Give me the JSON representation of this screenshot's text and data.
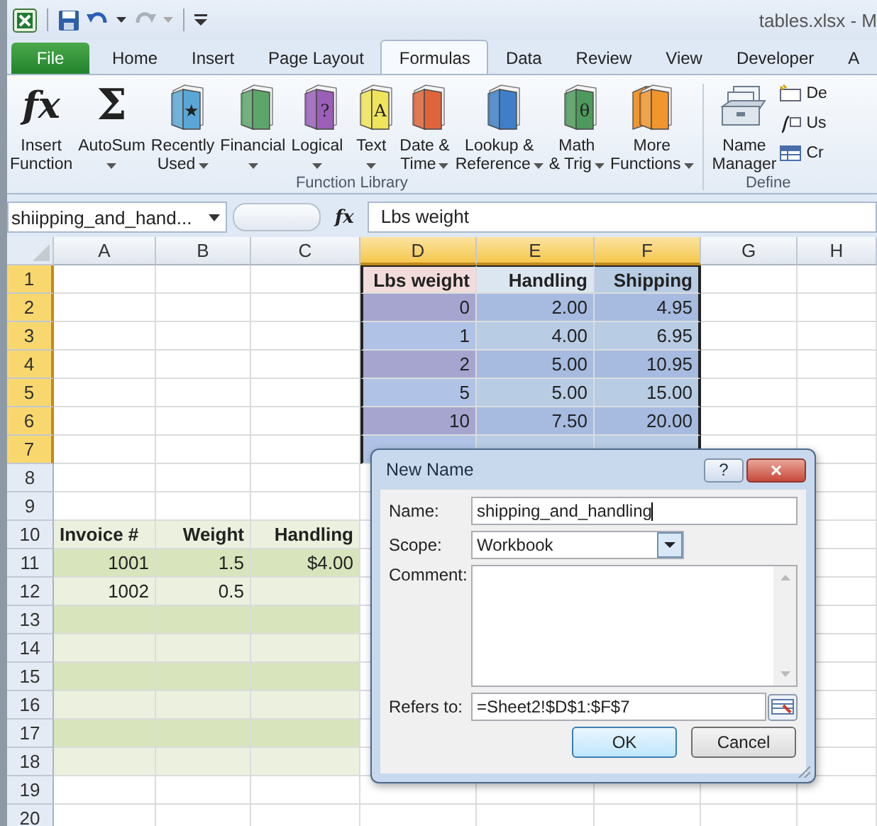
{
  "title_bar": {
    "title": "tables.xlsx  -  M"
  },
  "tabs": [
    {
      "label": "File",
      "kind": "file",
      "selected": false
    },
    {
      "label": "Home",
      "kind": "tab",
      "selected": false
    },
    {
      "label": "Insert",
      "kind": "tab",
      "selected": false
    },
    {
      "label": "Page Layout",
      "kind": "tab",
      "selected": false
    },
    {
      "label": "Formulas",
      "kind": "tab",
      "selected": true
    },
    {
      "label": "Data",
      "kind": "tab",
      "selected": false
    },
    {
      "label": "Review",
      "kind": "tab",
      "selected": false
    },
    {
      "label": "View",
      "kind": "tab",
      "selected": false
    },
    {
      "label": "Developer",
      "kind": "tab",
      "selected": false
    },
    {
      "label": "A",
      "kind": "tab",
      "selected": false
    }
  ],
  "ribbon": {
    "groups": [
      {
        "label": "Function Library",
        "buttons": [
          {
            "lines": [
              "Insert",
              "Function"
            ],
            "kind": "glyph",
            "glyph": "fx",
            "dropdown": false
          },
          {
            "lines": [
              "AutoSum"
            ],
            "kind": "glyph",
            "glyph": "Σ",
            "dropdown": true
          },
          {
            "lines": [
              "Recently",
              "Used"
            ],
            "kind": "book",
            "color": "#5aa7d6",
            "glyph": "★",
            "dropdown": true
          },
          {
            "lines": [
              "Financial"
            ],
            "kind": "book",
            "color": "#5ea56a",
            "dropdown": true
          },
          {
            "lines": [
              "Logical"
            ],
            "kind": "book",
            "color": "#9b5fb8",
            "glyph": "?",
            "dropdown": true
          },
          {
            "lines": [
              "Text"
            ],
            "kind": "book",
            "color": "#efe45a",
            "glyph": "A",
            "dropdown": true
          },
          {
            "lines": [
              "Date &",
              "Time"
            ],
            "kind": "book",
            "color": "#e0643a",
            "dropdown": true
          },
          {
            "lines": [
              "Lookup &",
              "Reference"
            ],
            "kind": "book",
            "color": "#3f7fc8",
            "dropdown": true
          },
          {
            "lines": [
              "Math",
              "& Trig"
            ],
            "kind": "book",
            "color": "#4e9a5c",
            "glyph": "θ",
            "dropdown": true
          },
          {
            "lines": [
              "More",
              "Functions"
            ],
            "kind": "books",
            "color": "#f0962e",
            "dropdown": true
          }
        ]
      },
      {
        "label": "Define",
        "buttons": [
          {
            "lines": [
              "Name",
              "Manager"
            ],
            "kind": "cards",
            "dropdown": false
          }
        ],
        "small_buttons": [
          {
            "label": "De",
            "kind": "tag"
          },
          {
            "label": "Us",
            "kind": "fx"
          },
          {
            "label": "Cr",
            "kind": "grid"
          }
        ]
      }
    ]
  },
  "formula_bar": {
    "name_box": "shiipping_and_hand...",
    "function_glyph": "fx",
    "value": "Lbs weight"
  },
  "sheet": {
    "columns": [
      {
        "label": "A",
        "selected": false
      },
      {
        "label": "B",
        "selected": false
      },
      {
        "label": "C",
        "selected": false
      },
      {
        "label": "D",
        "selected": true
      },
      {
        "label": "E",
        "selected": true
      },
      {
        "label": "F",
        "selected": true
      },
      {
        "label": "G",
        "selected": false
      },
      {
        "label": "H",
        "selected": false
      }
    ],
    "rows": [
      {
        "label": "1",
        "selected": true,
        "kind": "header",
        "cells": [
          null,
          null,
          null,
          "Lbs weight",
          "Handling",
          "Shipping",
          null,
          null
        ]
      },
      {
        "label": "2",
        "selected": true,
        "cells": [
          null,
          null,
          null,
          "0",
          "2.00",
          "4.95",
          null,
          null
        ]
      },
      {
        "label": "3",
        "selected": true,
        "cells": [
          null,
          null,
          null,
          "1",
          "4.00",
          "6.95",
          null,
          null
        ]
      },
      {
        "label": "4",
        "selected": true,
        "cells": [
          null,
          null,
          null,
          "2",
          "5.00",
          "10.95",
          null,
          null
        ]
      },
      {
        "label": "5",
        "selected": true,
        "cells": [
          null,
          null,
          null,
          "5",
          "5.00",
          "15.00",
          null,
          null
        ]
      },
      {
        "label": "6",
        "selected": true,
        "cells": [
          null,
          null,
          null,
          "10",
          "7.50",
          "20.00",
          null,
          null
        ]
      },
      {
        "label": "7",
        "selected": true
      },
      {
        "label": "8",
        "selected": false
      },
      {
        "label": "9",
        "selected": false
      },
      {
        "label": "10",
        "selected": false,
        "kind": "header",
        "cells": [
          "Invoice #",
          "Weight",
          "Handling",
          null,
          null,
          null,
          null,
          null
        ]
      },
      {
        "label": "11",
        "selected": false,
        "cells": [
          "1001",
          "1.5",
          "$4.00",
          null,
          null,
          null,
          null,
          null
        ]
      },
      {
        "label": "12",
        "selected": false,
        "cells": [
          "1002",
          "0.5",
          null,
          null,
          null,
          null,
          null,
          null
        ]
      },
      {
        "label": "13",
        "selected": false
      },
      {
        "label": "14",
        "selected": false
      },
      {
        "label": "15",
        "selected": false
      },
      {
        "label": "16",
        "selected": false
      },
      {
        "label": "17",
        "selected": false
      },
      {
        "label": "18",
        "selected": false
      },
      {
        "label": "19",
        "selected": false
      },
      {
        "label": "20",
        "selected": false
      }
    ]
  },
  "dialog": {
    "title": "New Name",
    "help": "?",
    "close": "×",
    "name_label": "Name:",
    "name_value": "shipping_and_handling",
    "scope_label": "Scope:",
    "scope_value": "Workbook",
    "comment_label": "Comment:",
    "refers_label": "Refers to:",
    "refers_value": "=Sheet2!$D$1:$F$7",
    "buttons": [
      {
        "label": "OK",
        "default": true
      },
      {
        "label": "Cancel",
        "default": false
      }
    ]
  }
}
